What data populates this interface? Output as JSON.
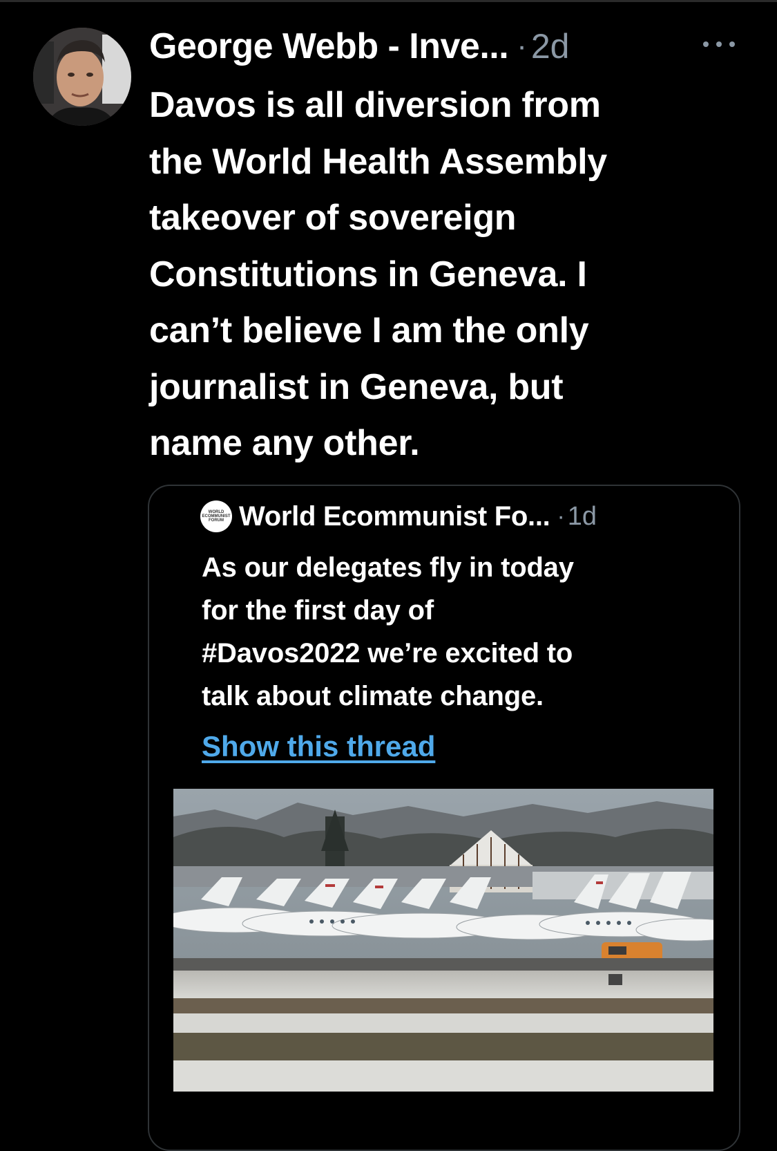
{
  "tweet": {
    "author_name": "George Webb - Inve...",
    "separator": "·",
    "timestamp": "2d",
    "more_label": "More",
    "text_lines": [
      "Davos is all diversion from",
      "the World Health Assembly",
      "takeover of sovereign",
      "Constitutions in Geneva. I",
      "can’t believe I am the only",
      "journalist in Geneva, but",
      "name any other."
    ]
  },
  "quote": {
    "logo_lines": [
      "WORLD",
      "ECOMMUNIST",
      "FORUM"
    ],
    "author_name": "World Ecommunist Fo...",
    "separator": "·",
    "timestamp": "1d",
    "text_lines": [
      "As our delegates fly in today",
      "for the first day of",
      "#Davos2022 we’re excited to",
      "talk about climate change."
    ],
    "show_thread_label": "Show this thread"
  },
  "colors": {
    "background": "#000000",
    "text": "#ffffff",
    "muted": "#8b98a5",
    "link": "#4fa9ea",
    "border": "#2f3336"
  },
  "icons": {
    "more": "more-horizontal-icon",
    "avatar": "user-avatar",
    "org_logo": "world-forum-logo"
  }
}
